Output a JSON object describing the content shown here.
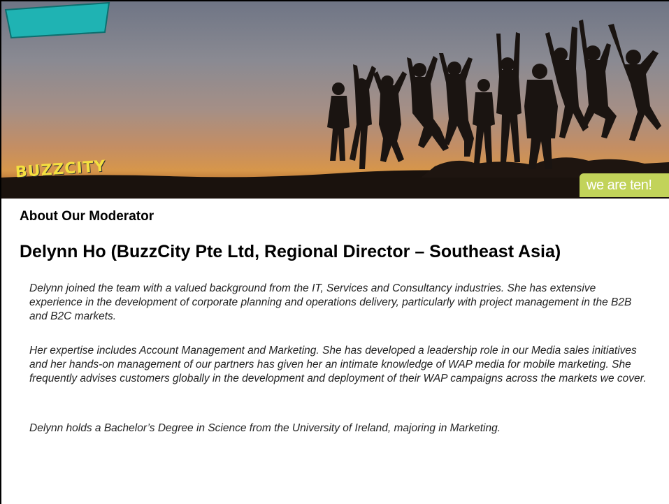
{
  "banner": {
    "logo_text": "BUZZCITY",
    "tagline": "we are ten!"
  },
  "about_heading": "About Our Moderator",
  "moderator_name": "Delynn Ho (BuzzCity Pte Ltd, Regional Director – Southeast Asia)",
  "paragraphs": [
    "Delynn joined the team with a valued background from the IT, Services and Consultancy industries. She has extensive experience in the development of corporate planning and operations delivery, particularly with project management in the B2B and B2C markets.",
    "Her expertise includes Account Management and Marketing. She has developed a leadership role in our Media sales initiatives and her hands-on management of our partners has given her an intimate knowledge of WAP media for mobile marketing. She frequently advises customers globally in the development and deployment of their WAP campaigns across the markets we cover.",
    "Delynn holds a Bachelor’s Degree in Science from the University of Ireland, majoring in Marketing."
  ],
  "colors": {
    "logo_panel": "#1fb3b3",
    "logo_text": "#f4e040",
    "tagline_panel": "#c2d35a",
    "text": "#000000"
  }
}
